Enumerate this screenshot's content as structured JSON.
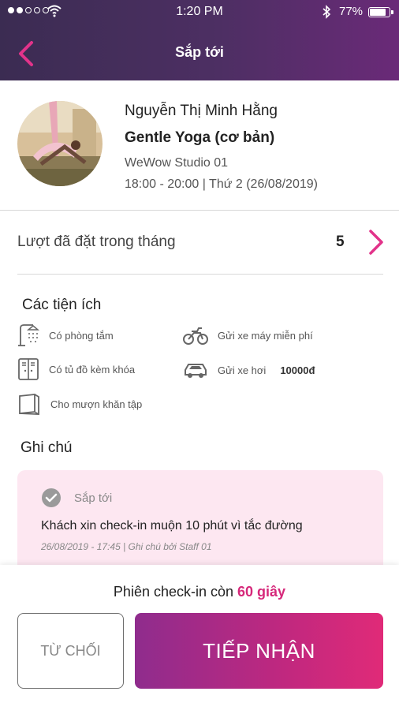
{
  "status_bar": {
    "time": "1:20 PM",
    "battery": "77%"
  },
  "header": {
    "title": "Sắp tới"
  },
  "booking": {
    "teacher": "Nguyễn Thị Minh Hằng",
    "class_name": "Gentle Yoga (cơ bản)",
    "studio": "WeWow Studio 01",
    "schedule": "18:00 - 20:00 | Thứ 2 (26/08/2019)"
  },
  "monthly_bookings": {
    "label": "Lượt đã đặt trong tháng",
    "count": "5"
  },
  "amenities": {
    "title": "Các tiện ích",
    "items": [
      {
        "label": "Có phòng tắm",
        "icon": "shower-icon"
      },
      {
        "label": "Gửi xe máy miễn phí",
        "icon": "motorbike-icon"
      },
      {
        "label": "Có tủ đồ kèm khóa",
        "icon": "locker-icon"
      },
      {
        "label": "Gửi xe hơi",
        "extra": "10000đ",
        "icon": "car-icon"
      },
      {
        "label": "Cho mượn khăn tập",
        "icon": "towel-icon"
      }
    ]
  },
  "notes": {
    "title": "Ghi chú",
    "status": "Sắp tới",
    "text": "Khách xin check-in muộn 10 phút vì tắc đường",
    "meta": "26/08/2019 - 17:45 | Ghi chú bởi Staff 01"
  },
  "session": {
    "prefix": "Phiên check-in còn",
    "seconds": "60 giây"
  },
  "actions": {
    "decline": "TỪ CHỐI",
    "accept": "TIẾP NHẬN"
  },
  "colors": {
    "accent": "#d6287a",
    "header_start": "#3b2c52",
    "header_end": "#6a2a78",
    "note_bg": "#fde7f1"
  }
}
